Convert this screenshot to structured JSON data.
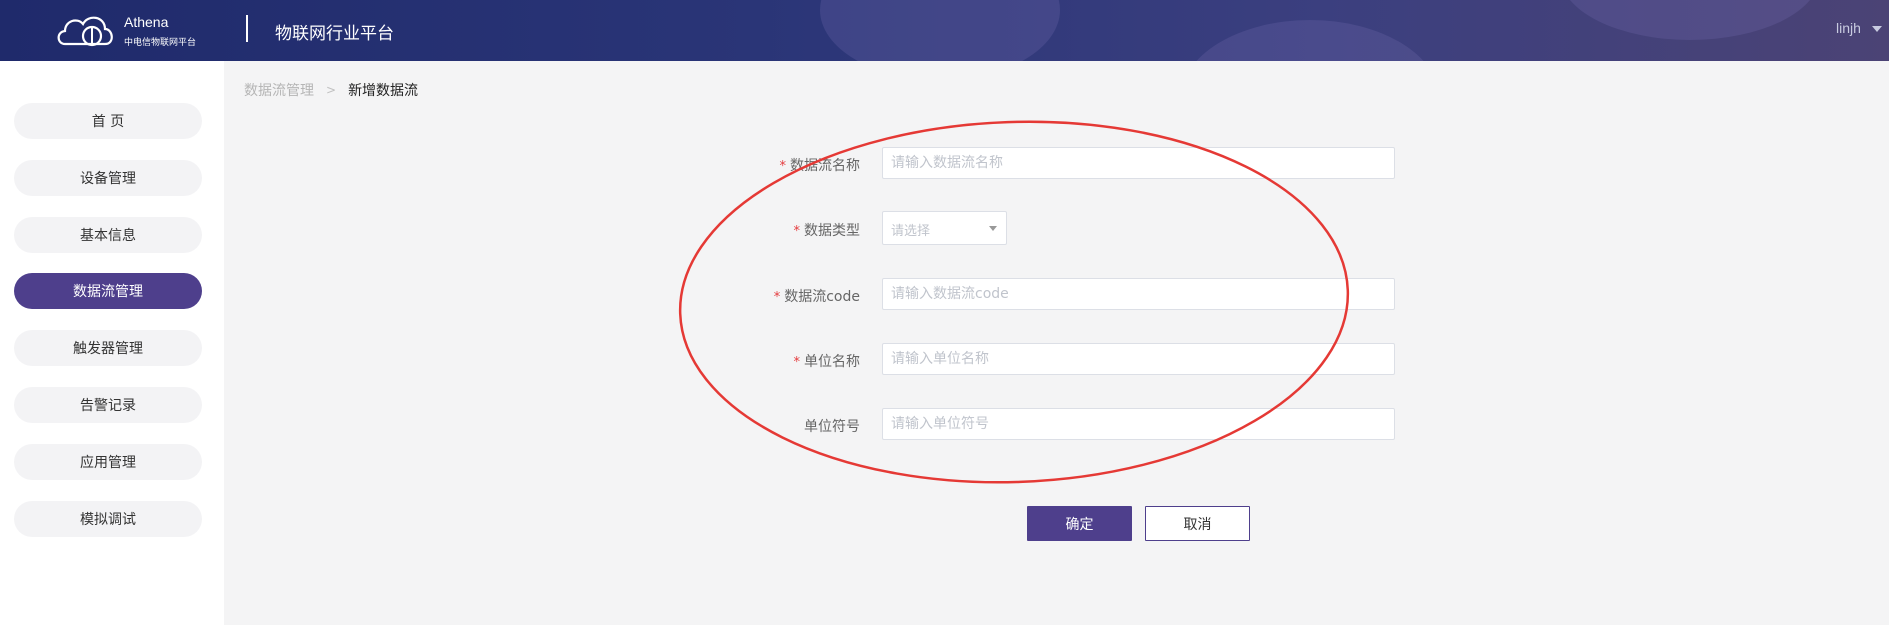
{
  "header": {
    "logo_name": "Athena",
    "logo_subtitle": "中电信物联网平台",
    "platform_title": "物联网行业平台",
    "user": "linjh"
  },
  "sidebar": {
    "items": [
      {
        "label": "首 页",
        "active": false
      },
      {
        "label": "设备管理",
        "active": false
      },
      {
        "label": "基本信息",
        "active": false
      },
      {
        "label": "数据流管理",
        "active": true
      },
      {
        "label": "触发器管理",
        "active": false
      },
      {
        "label": "告警记录",
        "active": false
      },
      {
        "label": "应用管理",
        "active": false
      },
      {
        "label": "模拟调试",
        "active": false
      }
    ]
  },
  "breadcrumb": {
    "parent": "数据流管理",
    "separator": ">",
    "current": "新增数据流"
  },
  "form": {
    "required_mark": "*",
    "fields": [
      {
        "label": "数据流名称",
        "required": true,
        "placeholder": "请输入数据流名称",
        "value": ""
      },
      {
        "label": "数据类型",
        "required": true,
        "placeholder": "请选择",
        "value": ""
      },
      {
        "label": "数据流code",
        "required": true,
        "placeholder": "请输入数据流code",
        "value": ""
      },
      {
        "label": "单位名称",
        "required": true,
        "placeholder": "请输入单位名称",
        "value": ""
      },
      {
        "label": "单位符号",
        "required": false,
        "placeholder": "请输入单位符号",
        "value": ""
      }
    ],
    "confirm_label": "确定",
    "cancel_label": "取消"
  },
  "colors": {
    "accent": "#4e3f8c",
    "header_bg": "#243073",
    "required": "#e4393c",
    "annotation": "#e53935"
  }
}
